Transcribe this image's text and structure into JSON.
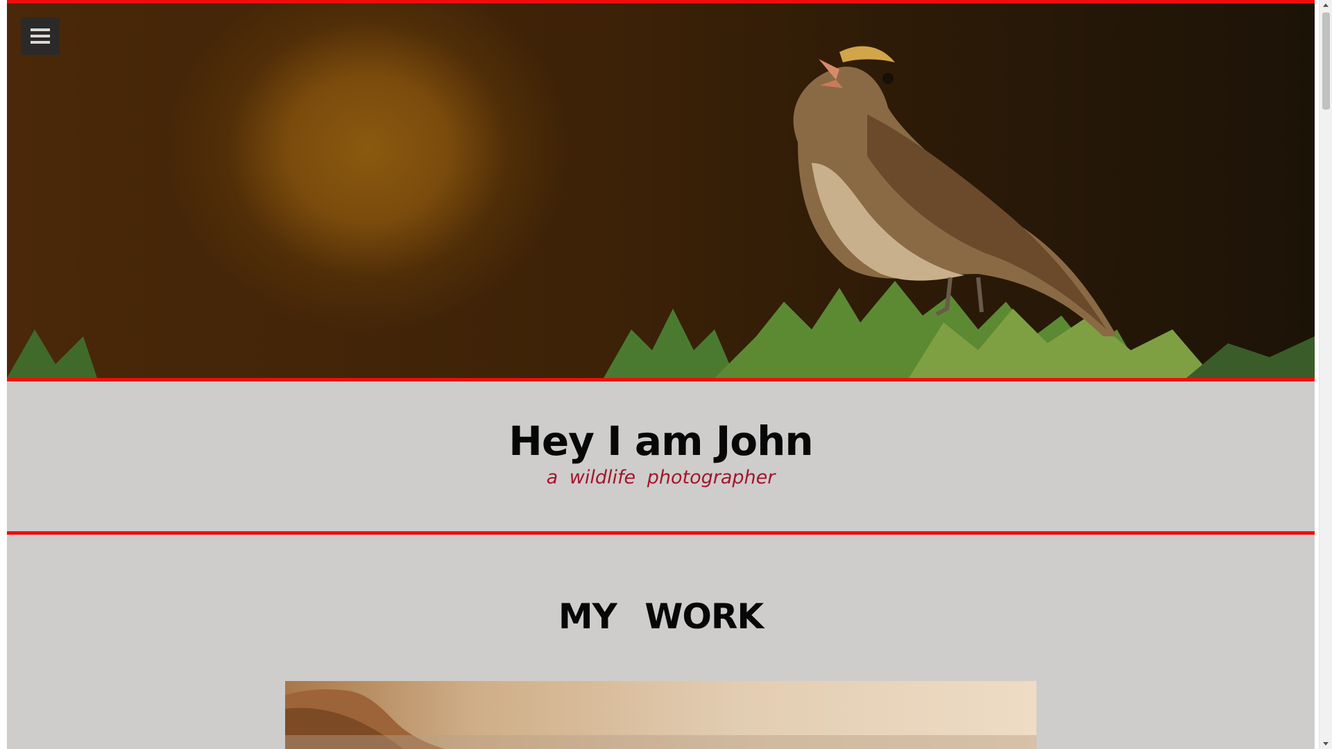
{
  "hero": {
    "image_subject": "songbird-on-pine-branch",
    "accent_color": "#ee0d0d"
  },
  "menu": {
    "icon": "hamburger-menu-icon"
  },
  "intro": {
    "heading": "Hey I am John",
    "tagline": "a wildlife photographer",
    "tagline_color": "#a3162a"
  },
  "work": {
    "heading": "MY  WORK",
    "photo_subject": "coastal-cliff-at-sunset"
  },
  "colors": {
    "page_background": "#cecdcc",
    "accent": "#ee0d0d",
    "text": "#070707"
  }
}
